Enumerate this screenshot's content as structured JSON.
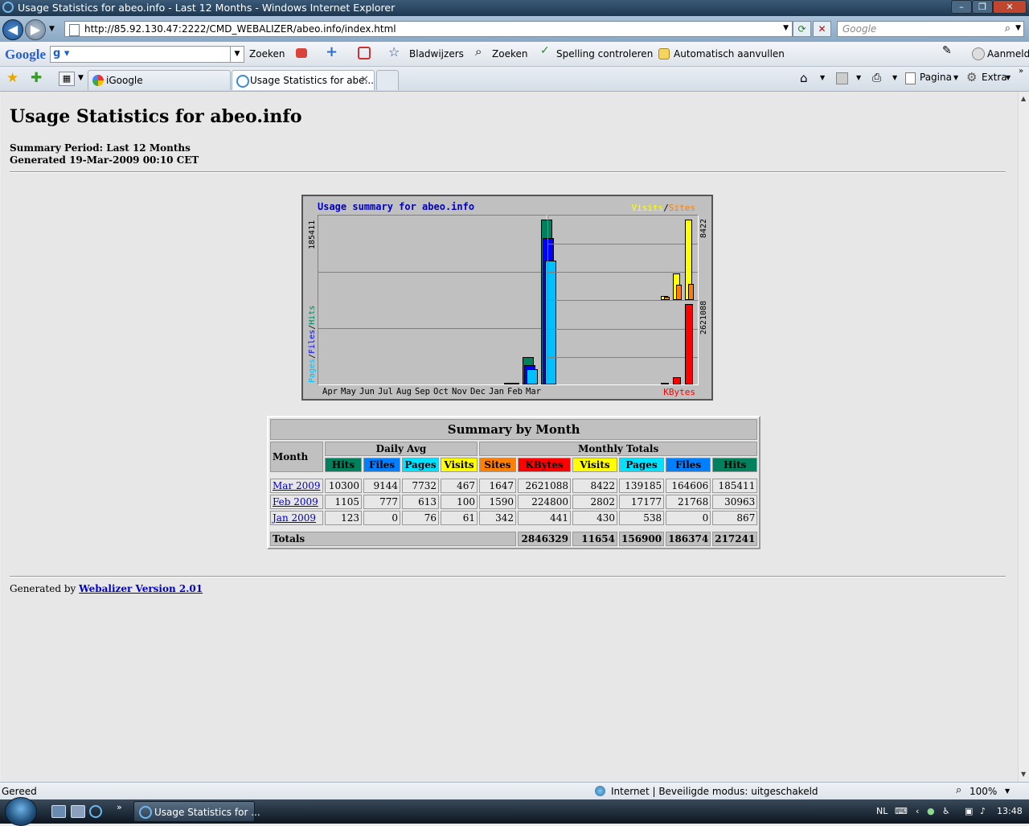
{
  "window": {
    "title": "Usage Statistics for abeo.info - Last 12 Months - Windows Internet Explorer"
  },
  "address": {
    "url": "http://85.92.130.47:2222/CMD_WEBALIZER/abeo.info/index.html",
    "search_placeholder": "Google"
  },
  "google_toolbar": {
    "logo": "Google",
    "search_btn": "Zoeken",
    "bookmarks": "Bladwijzers",
    "search2": "Zoeken",
    "spell": "Spelling controleren",
    "autofill": "Automatisch aanvullen",
    "signin": "Aanmelden"
  },
  "tabs": [
    {
      "label": "iGoogle"
    },
    {
      "label": "Usage Statistics for abe..."
    }
  ],
  "command_bar": {
    "page": "Pagina",
    "tools": "Extra"
  },
  "page": {
    "heading": "Usage Statistics for abeo.info",
    "period": "Summary Period: Last 12 Months",
    "generated": "Generated 19-Mar-2009 00:10 CET",
    "footer_prefix": "Generated by",
    "footer_link": "Webalizer Version 2.01"
  },
  "graph": {
    "title": "Usage summary for abeo.info",
    "visits_label": "Visits",
    "slash": "/",
    "sites_label": "Sites",
    "left_axis": {
      "pages": "Pages",
      "files": "Files",
      "hits": "Hits"
    },
    "left_max_label": "185411",
    "right_top_max_label": "8422",
    "right_bottom_max_label": "2621088",
    "kbytes_label": "KBytes",
    "months": [
      "Apr",
      "May",
      "Jun",
      "Jul",
      "Aug",
      "Sep",
      "Oct",
      "Nov",
      "Dec",
      "Jan",
      "Feb",
      "Mar"
    ],
    "colors": {
      "hits": "#00805c",
      "files": "#0000ff",
      "pages": "#00c0ff",
      "visits": "#ffff00",
      "sites": "#ff8000",
      "kbytes": "#ff0000"
    }
  },
  "chart_data": {
    "type": "bar",
    "title": "Usage summary for abeo.info",
    "categories": [
      "Apr",
      "May",
      "Jun",
      "Jul",
      "Aug",
      "Sep",
      "Oct",
      "Nov",
      "Dec",
      "Jan",
      "Feb",
      "Mar"
    ],
    "series": [
      {
        "name": "Hits",
        "values": [
          0,
          0,
          0,
          0,
          0,
          0,
          0,
          0,
          0,
          867,
          30963,
          185411
        ]
      },
      {
        "name": "Files",
        "values": [
          0,
          0,
          0,
          0,
          0,
          0,
          0,
          0,
          0,
          0,
          21768,
          164606
        ]
      },
      {
        "name": "Pages",
        "values": [
          0,
          0,
          0,
          0,
          0,
          0,
          0,
          0,
          0,
          538,
          17177,
          139185
        ]
      },
      {
        "name": "Visits",
        "values": [
          0,
          0,
          0,
          0,
          0,
          0,
          0,
          0,
          0,
          430,
          2802,
          8422
        ]
      },
      {
        "name": "Sites",
        "values": [
          0,
          0,
          0,
          0,
          0,
          0,
          0,
          0,
          0,
          342,
          1590,
          1647
        ]
      },
      {
        "name": "KBytes",
        "values": [
          0,
          0,
          0,
          0,
          0,
          0,
          0,
          0,
          0,
          441,
          224800,
          2621088
        ]
      }
    ]
  },
  "table": {
    "caption": "Summary by Month",
    "month_header": "Month",
    "daily_avg": "Daily Avg",
    "monthly_totals": "Monthly Totals",
    "columns": [
      "Hits",
      "Files",
      "Pages",
      "Visits",
      "Sites",
      "KBytes",
      "Visits",
      "Pages",
      "Files",
      "Hits"
    ],
    "rows": [
      {
        "month": "Mar 2009",
        "vals": [
          "10300",
          "9144",
          "7732",
          "467",
          "1647",
          "2621088",
          "8422",
          "139185",
          "164606",
          "185411"
        ]
      },
      {
        "month": "Feb 2009",
        "vals": [
          "1105",
          "777",
          "613",
          "100",
          "1590",
          "224800",
          "2802",
          "17177",
          "21768",
          "30963"
        ]
      },
      {
        "month": "Jan 2009",
        "vals": [
          "123",
          "0",
          "76",
          "61",
          "342",
          "441",
          "430",
          "538",
          "0",
          "867"
        ]
      }
    ],
    "totals_label": "Totals",
    "totals": [
      "2846329",
      "11654",
      "156900",
      "186374",
      "217241"
    ]
  },
  "status": {
    "left": "Gereed",
    "zone": "Internet | Beveiligde modus: uitgeschakeld",
    "zoom": "100%"
  },
  "taskbar": {
    "task": "Usage Statistics for ...",
    "lang": "NL",
    "time": "13:48"
  }
}
